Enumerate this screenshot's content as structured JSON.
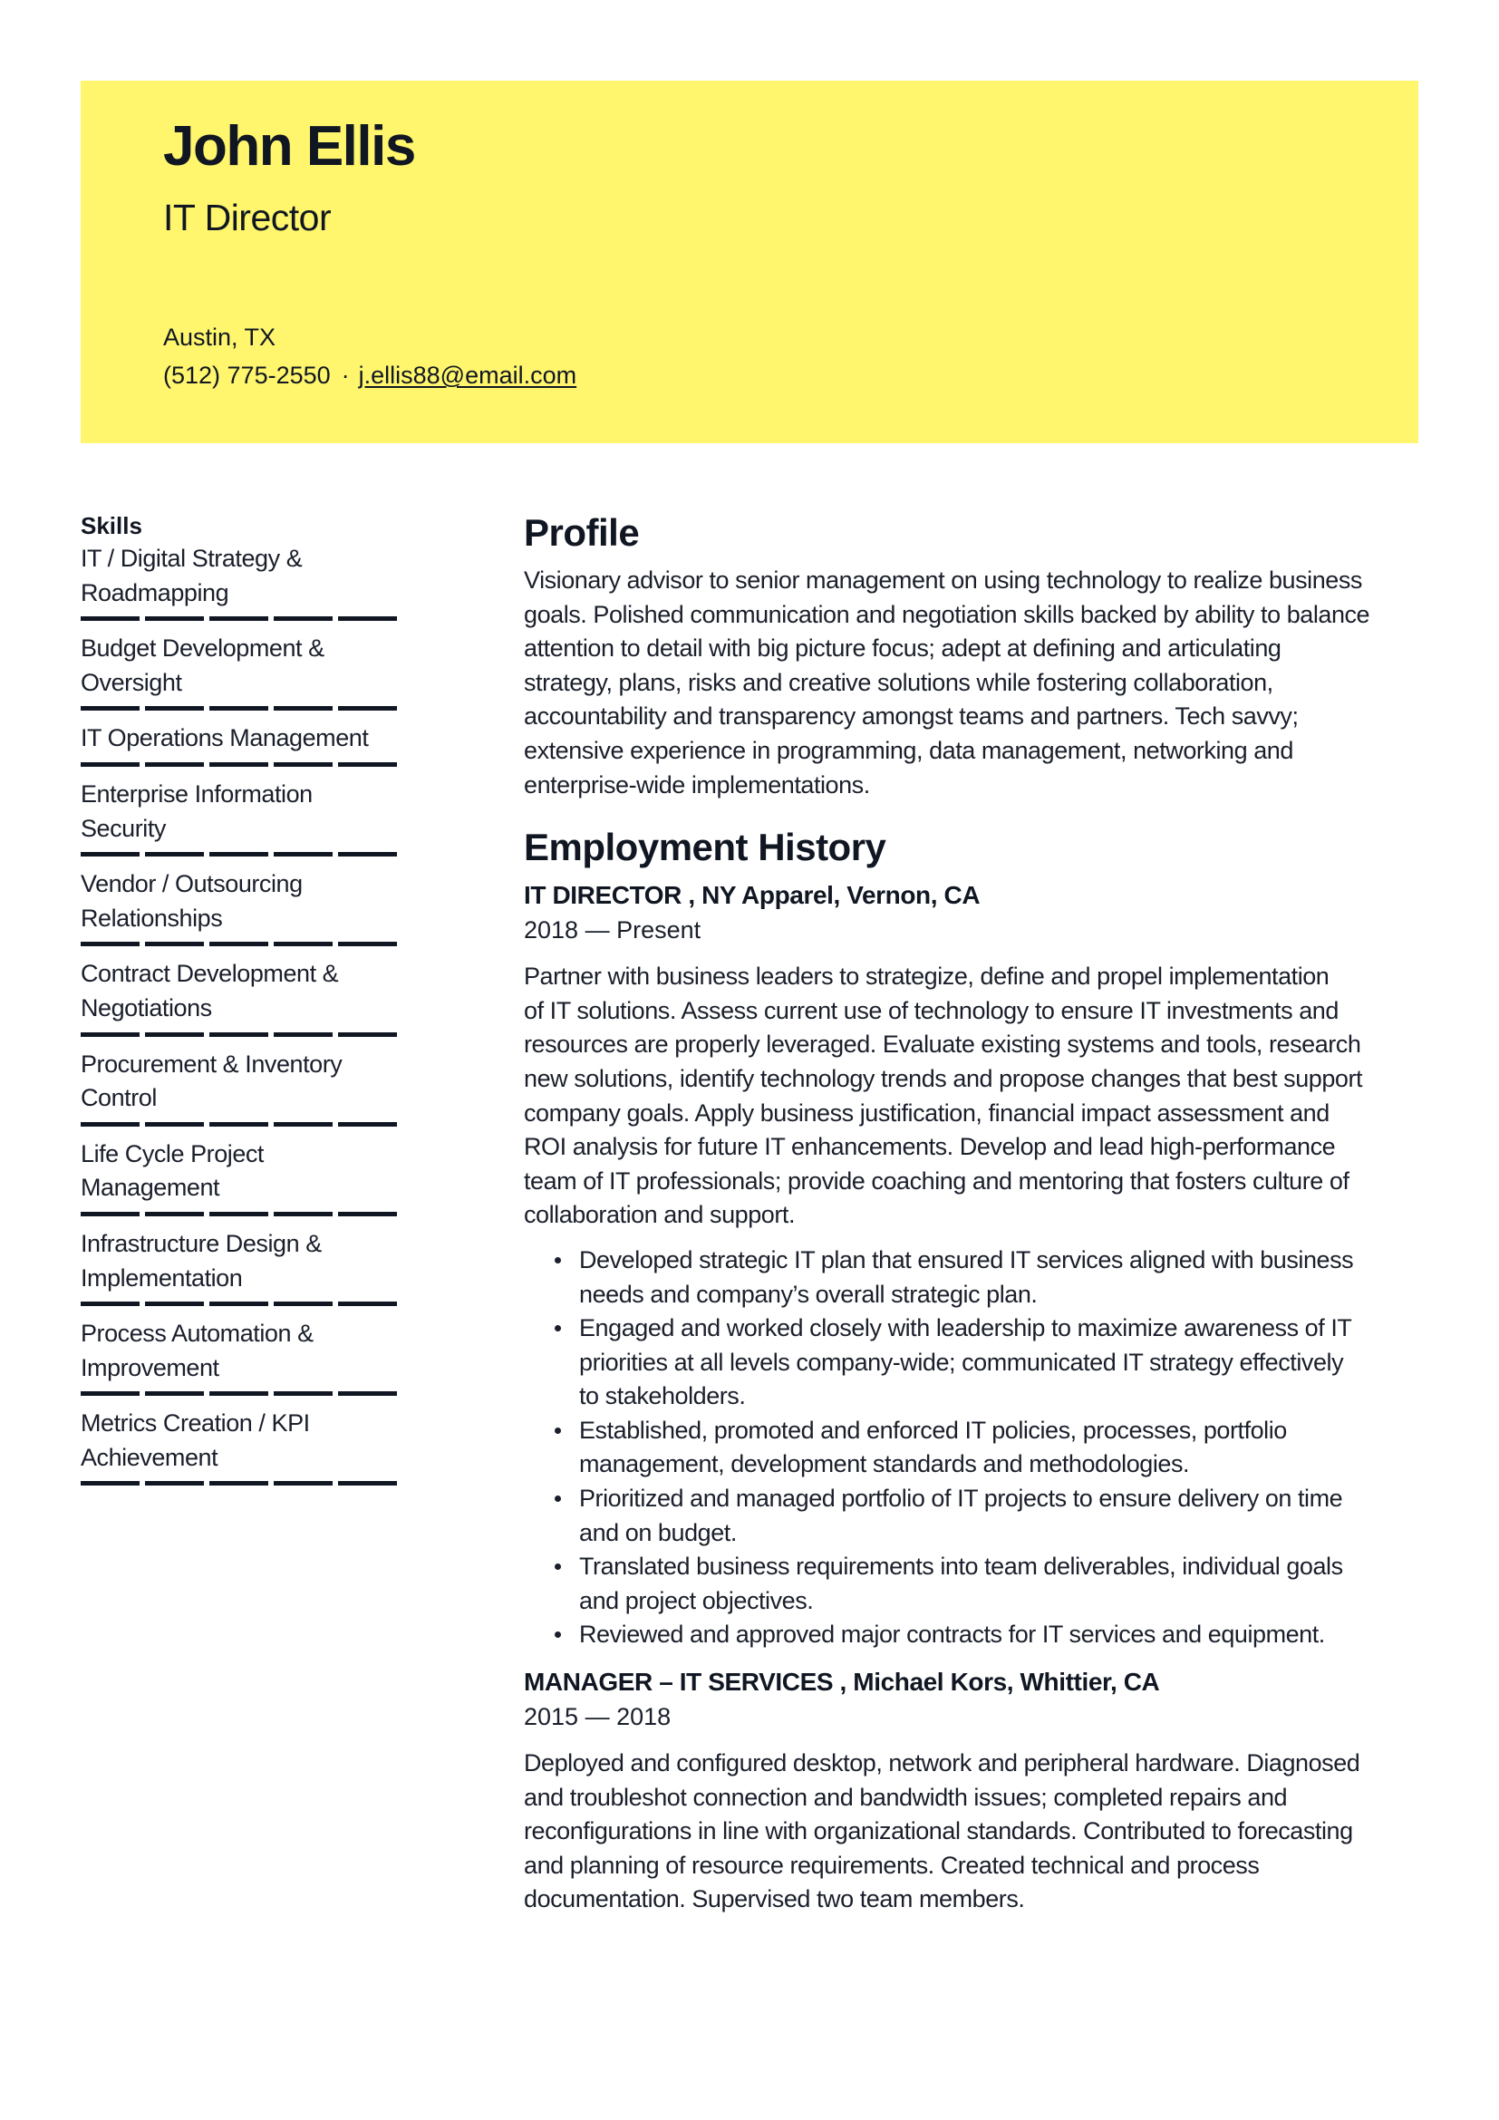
{
  "header": {
    "name": "John Ellis",
    "title": "IT Director",
    "location": "Austin, TX",
    "phone": "(512) 775-2550",
    "separator": "·",
    "email": "j.ellis88@email.com",
    "background_color": "#fff66e"
  },
  "skills": {
    "heading": "Skills",
    "items": [
      {
        "lines": [
          "IT / Digital Strategy &",
          "Roadmapping"
        ],
        "level": 5,
        "max": 5
      },
      {
        "lines": [
          "Budget Development &",
          "Oversight"
        ],
        "level": 5,
        "max": 5
      },
      {
        "lines": [
          "IT Operations Management"
        ],
        "level": 5,
        "max": 5
      },
      {
        "lines": [
          "Enterprise Information",
          "Security"
        ],
        "level": 5,
        "max": 5
      },
      {
        "lines": [
          "Vendor / Outsourcing",
          "Relationships"
        ],
        "level": 5,
        "max": 5
      },
      {
        "lines": [
          "Contract Development &",
          "Negotiations"
        ],
        "level": 5,
        "max": 5
      },
      {
        "lines": [
          "Procurement & Inventory",
          "Control"
        ],
        "level": 5,
        "max": 5
      },
      {
        "lines": [
          "Life Cycle Project",
          "Management"
        ],
        "level": 5,
        "max": 5
      },
      {
        "lines": [
          "Infrastructure Design &",
          "Implementation"
        ],
        "level": 5,
        "max": 5
      },
      {
        "lines": [
          "Process Automation &",
          "Improvement"
        ],
        "level": 5,
        "max": 5
      },
      {
        "lines": [
          "Metrics Creation / KPI",
          "Achievement"
        ],
        "level": 5,
        "max": 5
      }
    ]
  },
  "profile": {
    "heading": "Profile",
    "lines": [
      "Visionary advisor to senior management on using technology to realize business",
      "goals. Polished communication and negotiation skills backed by ability to balance",
      "attention to detail with big picture focus; adept at defining and articulating",
      "strategy, plans, risks and creative solutions while fostering collaboration,",
      "accountability and transparency amongst teams and partners. Tech savvy;",
      "extensive experience in programming, data management, networking and",
      "enterprise-wide implementations."
    ]
  },
  "employment": {
    "heading": "Employment History",
    "jobs": [
      {
        "title_line": "IT DIRECTOR , NY Apparel, Vernon, CA",
        "dates": "2018 — Present",
        "description_lines": [
          "Partner with business leaders to strategize, define and propel implementation",
          "of IT solutions. Assess current use of technology to ensure IT investments and",
          "resources are properly leveraged. Evaluate existing systems and tools, research",
          "new solutions, identify technology trends and propose changes that best support",
          "company goals. Apply business justification, financial impact assessment and",
          "ROI analysis for future IT enhancements. Develop and lead high-performance",
          "team of IT professionals; provide coaching and mentoring that fosters culture of",
          "collaboration and support."
        ],
        "bullets": [
          [
            "Developed strategic IT plan that ensured IT services aligned with business",
            "needs and company’s overall strategic plan."
          ],
          [
            "Engaged and worked closely with leadership to maximize awareness of IT",
            "priorities at all levels company-wide; communicated IT strategy effectively",
            "to stakeholders."
          ],
          [
            "Established, promoted and enforced IT policies, processes, portfolio",
            "management, development standards and methodologies."
          ],
          [
            "Prioritized and managed portfolio of IT projects to ensure delivery on time",
            "and on budget."
          ],
          [
            "Translated business requirements into team deliverables, individual goals",
            "and project objectives."
          ],
          [
            "Reviewed and approved major contracts for IT services and equipment."
          ]
        ]
      },
      {
        "title_line": "MANAGER – IT SERVICES , Michael Kors, Whittier, CA",
        "dates": "2015 — 2018",
        "description_lines": [
          "Deployed and configured desktop, network and peripheral hardware. Diagnosed",
          "and troubleshot connection and bandwidth issues; completed repairs and",
          "reconfigurations in line with organizational standards. Contributed to forecasting",
          "and planning of resource requirements. Created technical and process",
          "documentation. Supervised two team members."
        ],
        "bullets": []
      }
    ]
  }
}
